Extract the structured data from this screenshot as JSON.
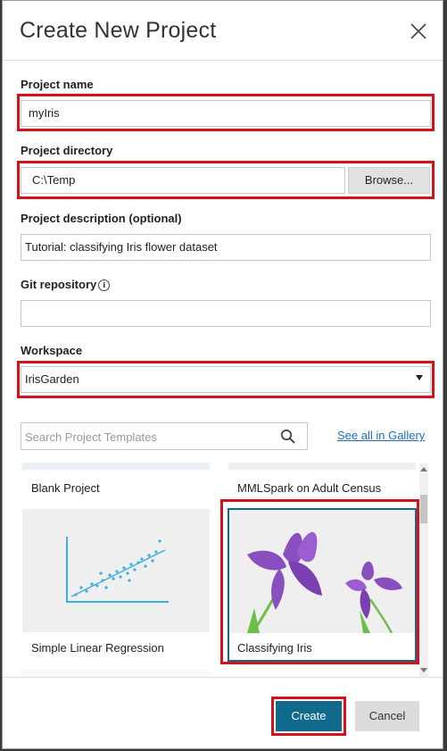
{
  "dialog": {
    "title": "Create New Project",
    "close_icon": "close-icon"
  },
  "fields": {
    "project_name": {
      "label": "Project name",
      "value": "myIris"
    },
    "project_directory": {
      "label": "Project directory",
      "value": "C:\\Temp",
      "browse_label": "Browse..."
    },
    "project_description": {
      "label": "Project description (optional)",
      "value": "Tutorial: classifying Iris flower dataset"
    },
    "git_repository": {
      "label": "Git repository",
      "info_glyph": "i",
      "value": ""
    },
    "workspace": {
      "label": "Workspace",
      "value": "IrisGarden"
    }
  },
  "templates": {
    "search_placeholder": "Search Project Templates",
    "gallery_link": "See all in Gallery",
    "items": [
      {
        "label": "Blank Project"
      },
      {
        "label": "MMLSpark on Adult Census"
      },
      {
        "label": "Simple Linear Regression"
      },
      {
        "label": "Classifying Iris"
      }
    ],
    "selected": "Classifying Iris"
  },
  "footer": {
    "create_label": "Create",
    "cancel_label": "Cancel"
  },
  "colors": {
    "accent": "#106a8e",
    "highlight": "#d6111a",
    "link": "#1f6fb8",
    "iris_purple": "#8a4fbf",
    "stem_green": "#6ebf4a"
  }
}
